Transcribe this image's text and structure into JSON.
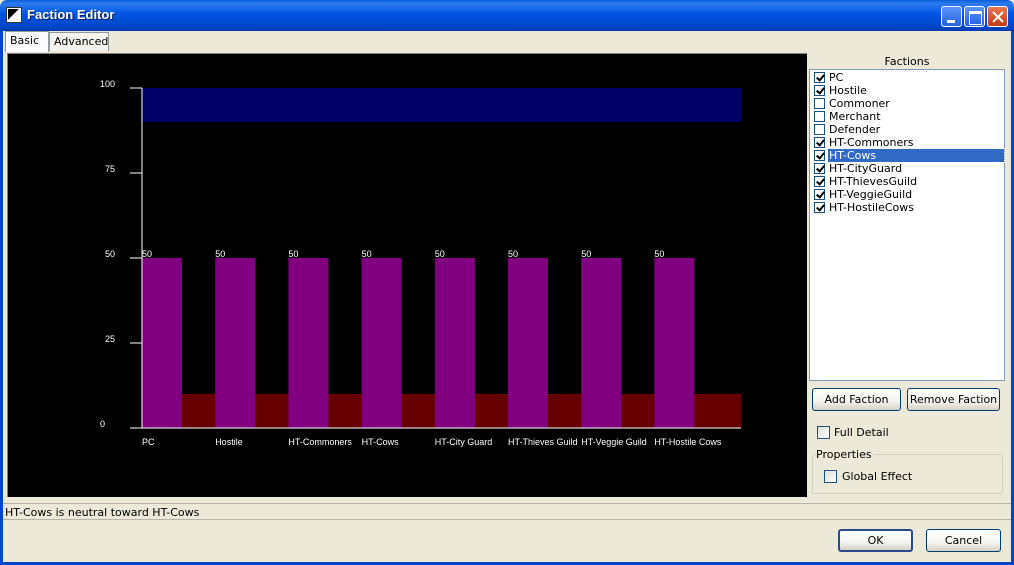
{
  "window": {
    "title": "Faction Editor"
  },
  "tabs": [
    {
      "label": "Basic",
      "active": true
    },
    {
      "label": "Advanced",
      "active": false
    }
  ],
  "chart_data": {
    "type": "bar",
    "categories": [
      "PC",
      "Hostile",
      "HT-Commoners",
      "HT-Cows",
      "HT-City Guard",
      "HT-Thieves Guild",
      "HT-Veggie Guild",
      "HT-Hostile Cows"
    ],
    "series": [
      {
        "values": [
          50,
          50,
          50,
          50,
          50,
          50,
          50,
          50
        ],
        "color": "#800080"
      }
    ],
    "data_labels": [
      "50",
      "50",
      "50",
      "50",
      "50",
      "50",
      "50",
      "50"
    ],
    "threshold_bands": [
      {
        "from": 90,
        "to": 100,
        "color": "#000066"
      },
      {
        "from": 0,
        "to": 10,
        "color": "#660000"
      }
    ],
    "yticks": [
      "100",
      "75",
      "50",
      "25",
      "0"
    ],
    "ylim": [
      0,
      100
    ],
    "background": "#000000",
    "axis_color": "#ffffff"
  },
  "factions": {
    "header": "Factions",
    "items": [
      {
        "label": "PC",
        "checked": true,
        "selected": false
      },
      {
        "label": "Hostile",
        "checked": true,
        "selected": false
      },
      {
        "label": "Commoner",
        "checked": false,
        "selected": false
      },
      {
        "label": "Merchant",
        "checked": false,
        "selected": false
      },
      {
        "label": "Defender",
        "checked": false,
        "selected": false
      },
      {
        "label": "HT-Commoners",
        "checked": true,
        "selected": false
      },
      {
        "label": "HT-Cows",
        "checked": true,
        "selected": true
      },
      {
        "label": "HT-CityGuard",
        "checked": true,
        "selected": false
      },
      {
        "label": "HT-ThievesGuild",
        "checked": true,
        "selected": false
      },
      {
        "label": "HT-VeggieGuild",
        "checked": true,
        "selected": false
      },
      {
        "label": "HT-HostileCows",
        "checked": true,
        "selected": false
      }
    ],
    "add_label": "Add Faction",
    "remove_label": "Remove Faction",
    "full_detail_label": "Full Detail",
    "full_detail_checked": false
  },
  "properties": {
    "title": "Properties",
    "global_effect_label": "Global Effect",
    "global_effect_checked": false
  },
  "status": {
    "text": "HT-Cows is neutral toward HT-Cows"
  },
  "dialog": {
    "ok_label": "OK",
    "cancel_label": "Cancel"
  }
}
